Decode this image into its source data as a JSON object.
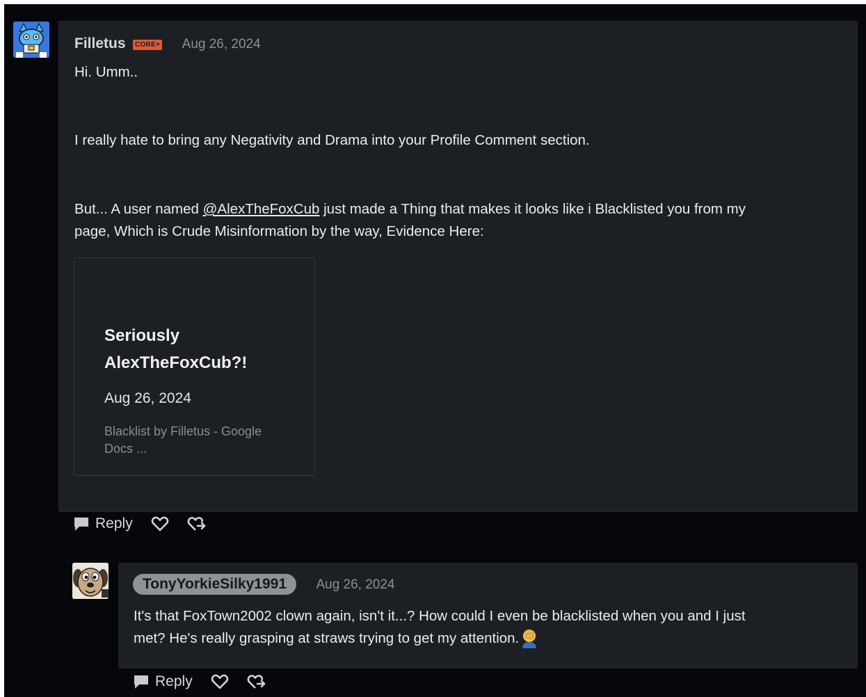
{
  "comments": [
    {
      "username": "Filletus",
      "badge": "CORE+",
      "date": "Aug 26, 2024",
      "paragraphs": {
        "p1": "Hi. Umm..",
        "p2": "I really hate to bring any Negativity and Drama into your Profile Comment section.",
        "p3_before": "But... A user named ",
        "p3_mention": "@AlexTheFoxCub",
        "p3_after": " just made a Thing that makes it looks like i Blacklisted you from my",
        "p3_line2": "page, Which is Crude Misinformation by the way, Evidence Here:"
      },
      "link_card": {
        "title": "Seriously AlexTheFoxCub?!",
        "date": "Aug 26, 2024",
        "description": "Blacklist by Filletus - Google Docs ..."
      },
      "actions": {
        "reply_label": "Reply"
      }
    },
    {
      "username": "TonyYorkieSilky1991",
      "date": "Aug 26, 2024",
      "text_line1": "It's that FoxTown2002 clown again, isn't it...? How could I even be blacklisted when you and I just",
      "text_line2": "met? He's really grasping at straws trying to get my attention.",
      "actions": {
        "reply_label": "Reply"
      }
    }
  ],
  "icons": {
    "reply": "speech-bubble-icon",
    "like": "heart-icon",
    "share": "share-heart-icon",
    "emoji": "facepalm-emoji-icon"
  },
  "colors": {
    "background": "#06070b",
    "comment_bg": "#1c1f24",
    "badge": "#e4572e",
    "pill": "#8e9196"
  }
}
